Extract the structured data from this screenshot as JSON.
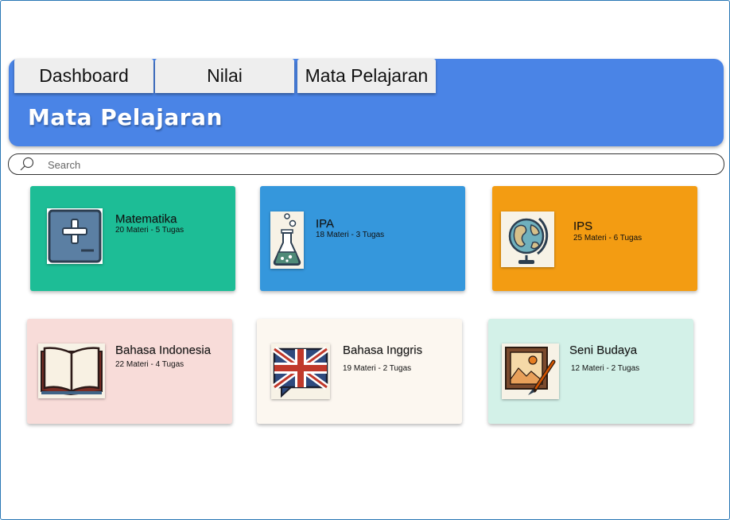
{
  "tabs": [
    {
      "label": "Dashboard"
    },
    {
      "label": "Nilai"
    },
    {
      "label": "Mata Pelajaran"
    }
  ],
  "page_title": "Mata Pelajaran",
  "search": {
    "placeholder": "Search",
    "icon": "search-icon"
  },
  "colors": {
    "header": "#4a84e6",
    "matematika": "#1dbd96",
    "ipa": "#3597dc",
    "ips": "#f39c12",
    "bahasa_indonesia": "#f8dcd9",
    "bahasa_inggris": "#fcf7f0",
    "seni_budaya": "#d3f1e8"
  },
  "subjects": [
    {
      "name": "Matematika",
      "meta": "20 Materi - 5 Tugas",
      "icon": "math-plus-minus-icon"
    },
    {
      "name": "IPA",
      "meta": "18 Materi - 3 Tugas",
      "icon": "flask-icon"
    },
    {
      "name": "IPS",
      "meta": "25 Materi - 6 Tugas",
      "icon": "globe-icon"
    },
    {
      "name": "Bahasa Indonesia",
      "meta": "22 Materi - 4 Tugas",
      "icon": "book-icon"
    },
    {
      "name": "Bahasa Inggris",
      "meta": "19 Materi - 2 Tugas",
      "icon": "uk-flag-speech-bubble-icon"
    },
    {
      "name": "Seni Budaya",
      "meta": "12 Materi - 2 Tugas",
      "icon": "picture-brush-icon"
    }
  ]
}
